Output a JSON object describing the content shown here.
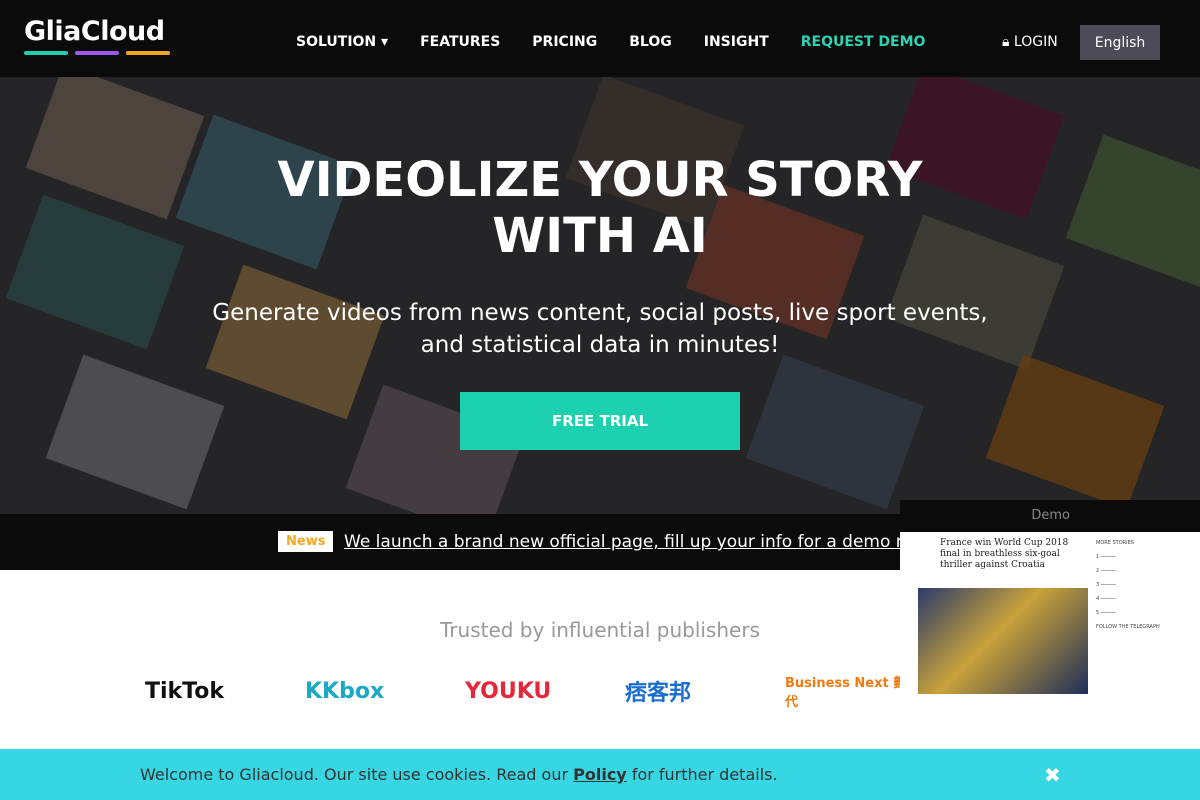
{
  "nav": {
    "logo": "GliaCloud",
    "logo_colors": [
      "#1dd1b0",
      "#9b59f0",
      "#f5a623"
    ],
    "items": [
      {
        "label": "SOLUTION ▾"
      },
      {
        "label": "FEATURES"
      },
      {
        "label": "PRICING"
      },
      {
        "label": "BLOG"
      },
      {
        "label": "INSIGHT"
      },
      {
        "label": "REQUEST DEMO"
      }
    ],
    "login": "LOGIN",
    "language": "English"
  },
  "hero": {
    "title_line1": "VIDEOLIZE YOUR STORY",
    "title_line2": "WITH AI",
    "subtitle_line1": "Generate videos from news content, social posts, live sport events,",
    "subtitle_line2": "and statistical data in minutes!",
    "cta": "FREE TRIAL"
  },
  "news": {
    "badge": "News",
    "text": "We launch a brand new official page, fill up your info for a demo request"
  },
  "trusted": {
    "heading": "Trusted by influential publishers",
    "logos": [
      "TikTok",
      "KKbox",
      "YOUKU",
      "痞客邦",
      "Business Next 數位時代"
    ]
  },
  "demo": {
    "label": "Demo",
    "headline": "France win World Cup 2018 final in breathless six-goal thriller against Croatia",
    "side_heading": "MORE STORIES",
    "follow": "FOLLOW THE TELEGRAPH"
  },
  "cookie": {
    "before": "Welcome to Gliacloud. Our site use cookies. Read our ",
    "policy": "Policy",
    "after": " for further details.",
    "close": "✖"
  },
  "colors": {
    "accent": "#1dd1b0",
    "cookie_bg": "#36d6e3",
    "news_badge": "#f5a623"
  }
}
